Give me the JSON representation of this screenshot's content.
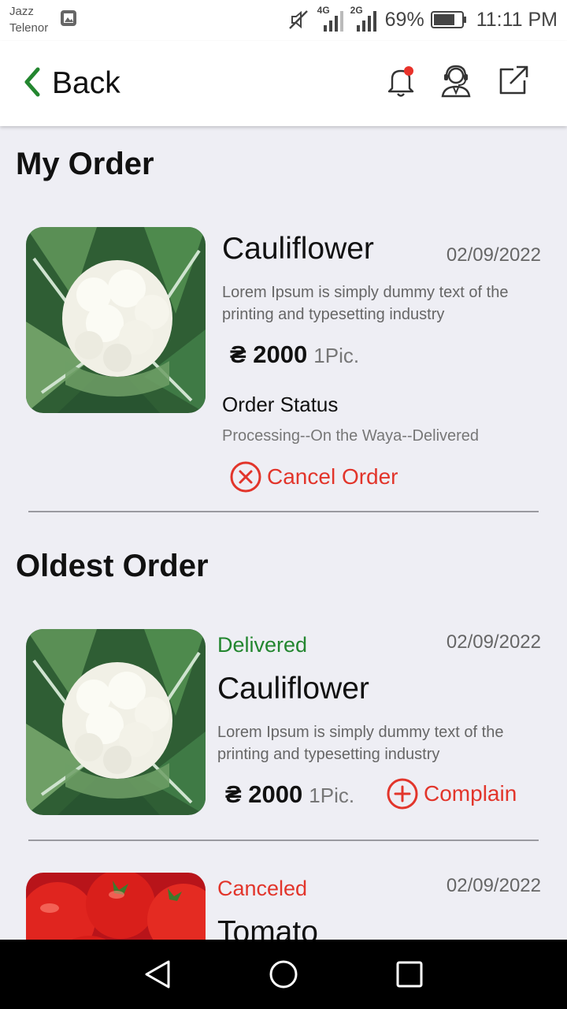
{
  "status_bar": {
    "carrier_1": "Jazz",
    "carrier_2": "Telenor",
    "net_1": "4G",
    "net_2": "2G",
    "battery": "69%",
    "time": "11:11 PM"
  },
  "header": {
    "back_label": "Back",
    "icons": [
      "notification-bell-icon",
      "customer-support-icon",
      "external-link-icon"
    ],
    "notification_dot_color": "#e8322a"
  },
  "my_order": {
    "title": "My Order",
    "item": {
      "name": "Cauliflower",
      "date": "02/09/2022",
      "description": "Lorem Ipsum is simply dummy text of the printing and typesetting industry",
      "price": "₴ 2000",
      "unit": "1Pic.",
      "status_label": "Order Status",
      "status_steps": "Processing--On the Waya--Delivered",
      "action_label": "Cancel Order",
      "image": "cauliflower-image"
    }
  },
  "oldest_order": {
    "title": "Oldest Order",
    "items": [
      {
        "badge": "Delivered",
        "badge_color": "#23862f",
        "date": "02/09/2022",
        "name": "Cauliflower",
        "description": "Lorem Ipsum is simply dummy text of the printing and typesetting industry",
        "price": "₴ 2000",
        "unit": "1Pic.",
        "action_label": "Complain",
        "image": "cauliflower-image"
      },
      {
        "badge": "Canceled",
        "badge_color": "#e2352b",
        "date": "02/09/2022",
        "name": "Tomato",
        "image": "tomato-image"
      }
    ]
  },
  "colors": {
    "accent_green": "#23862f",
    "danger_red": "#e2352b",
    "page_background": "#eeeef4"
  },
  "nav_bar": {
    "buttons": [
      "back-triangle-icon",
      "home-circle-icon",
      "recents-square-icon"
    ]
  }
}
